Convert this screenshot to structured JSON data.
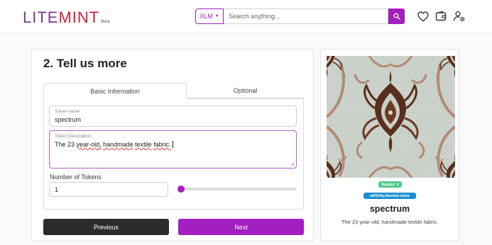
{
  "header": {
    "logo_text_1": "LITE",
    "logo_text_2": "MINT",
    "logo_beta": "Beta",
    "asset_select": "XLM",
    "search_placeholder": "Search anything..."
  },
  "icons": {
    "search": "search-icon",
    "favorites": "heart-icon",
    "wallet": "wallet-icon",
    "account": "user-settings-icon"
  },
  "form": {
    "title": "2. Tell us more",
    "tabs": [
      {
        "label": "Basic Information",
        "active": true
      },
      {
        "label": "Optional",
        "active": false
      }
    ],
    "token_name_label": "Token name",
    "token_name_value": "spectrum",
    "token_desc_label": "Token Description",
    "token_desc_words": [
      "The",
      "23",
      "year-old,",
      "handmade",
      "textile",
      "fabric."
    ],
    "num_tokens_label": "Number of Tokens",
    "num_tokens_value": "1",
    "slider_fraction": 0,
    "previous_label": "Previous",
    "next_label": "Next"
  },
  "preview": {
    "supply_badge": "Supply: 1",
    "store_badge": "w6524q.litemint.store",
    "name": "spectrum",
    "description": "The 23 year-old, handmade textile fabric."
  },
  "colors": {
    "accent": "#a41fbf",
    "dark_button": "#2b2b2b",
    "supply_badge": "#4cc98a",
    "store_badge": "#1b8fd0"
  }
}
